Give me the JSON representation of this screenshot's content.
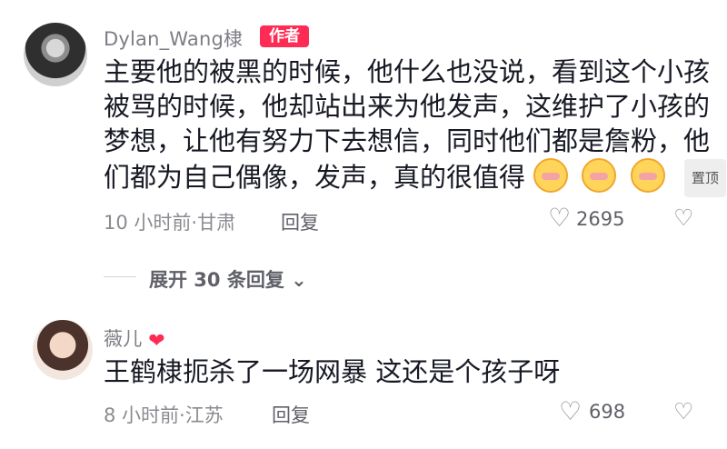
{
  "comments": [
    {
      "username": "Dylan_Wang棣",
      "badge": "作者",
      "lines": [
        "主要他的被黑的时候，他什么也没说，看到这个小孩",
        "被骂的时候，他却站出来为他发声，这维护了小孩的",
        "梦想，让他有努力下去想信，同时他们都是詹粉，他",
        "们都为自己偶像，发声，真的很值得"
      ],
      "emoji_icons": [
        "crying-face-emoji",
        "crying-face-emoji",
        "crying-face-emoji"
      ],
      "pin_label": "置顶",
      "meta": "10 小时前·甘肃",
      "reply_label": "回复",
      "like_count": "2695",
      "icons": {
        "like": "heart-outline-icon",
        "dislike": "broken-heart-icon"
      }
    },
    {
      "username": "薇儿",
      "username_icon": "red-heart-icon",
      "text": "王鹤棣扼杀了一场网暴  这还是个孩子呀",
      "meta": "8 小时前·江苏",
      "reply_label": "回复",
      "like_count": "698",
      "icons": {
        "like": "heart-outline-icon",
        "dislike": "broken-heart-icon"
      }
    }
  ],
  "expand_replies": {
    "label": "展开 30 条回复",
    "icon": "chevron-down-icon"
  },
  "colors": {
    "accent": "#fe2c55",
    "secondary_text": "#8a8b91",
    "primary_text": "#161823"
  }
}
